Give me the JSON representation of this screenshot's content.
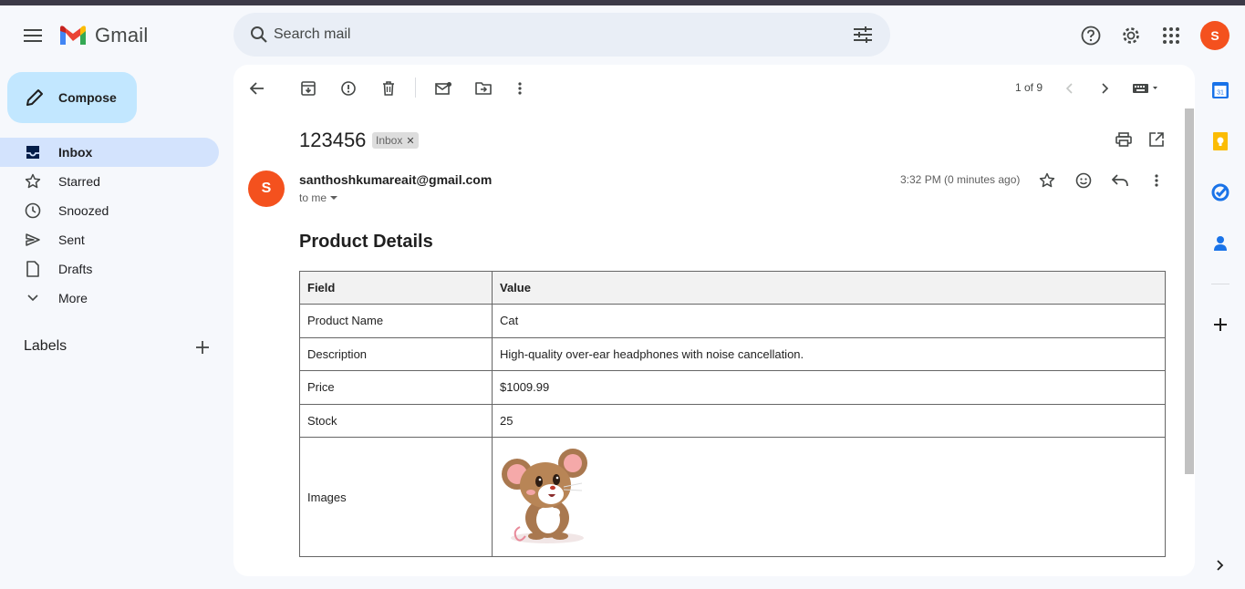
{
  "app": {
    "name": "Gmail"
  },
  "search": {
    "placeholder": "Search mail"
  },
  "user": {
    "initial": "S"
  },
  "sidebar": {
    "compose_label": "Compose",
    "items": [
      {
        "label": "Inbox",
        "icon": "inbox-icon",
        "active": true
      },
      {
        "label": "Starred",
        "icon": "star-icon"
      },
      {
        "label": "Snoozed",
        "icon": "clock-icon"
      },
      {
        "label": "Sent",
        "icon": "send-icon"
      },
      {
        "label": "Drafts",
        "icon": "draft-icon"
      },
      {
        "label": "More",
        "icon": "chevron-down-icon"
      }
    ],
    "labels_title": "Labels"
  },
  "toolbar": {
    "pager": "1 of 9"
  },
  "email": {
    "subject": "123456",
    "label_chip": "Inbox",
    "sender_initial": "S",
    "sender": "santhoshkumareait@gmail.com",
    "to": "to me",
    "time": "3:32 PM (0 minutes ago)",
    "body_title": "Product Details",
    "table": {
      "headers": [
        "Field",
        "Value"
      ],
      "rows": [
        [
          "Product Name",
          "Cat"
        ],
        [
          "Description",
          "High-quality over-ear headphones with noise cancellation."
        ],
        [
          "Price",
          "$1009.99"
        ],
        [
          "Stock",
          "25"
        ],
        [
          "Images",
          ""
        ]
      ]
    }
  },
  "colors": {
    "accent": "#0b57d0",
    "avatar": "#f4511e",
    "compose": "#c2e7ff",
    "active_nav": "#d3e3fd"
  }
}
